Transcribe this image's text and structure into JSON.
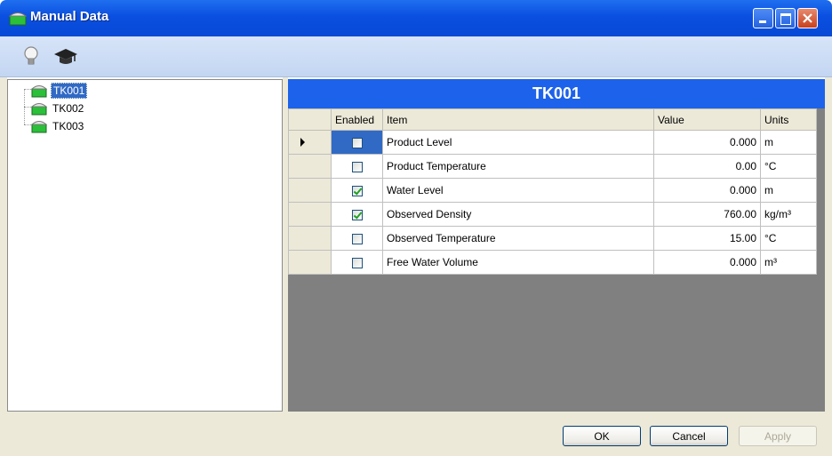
{
  "window": {
    "title": "Manual Data"
  },
  "toolbar": {
    "icons": [
      "lightbulb-icon",
      "graduation-cap-icon"
    ]
  },
  "tree": {
    "items": [
      {
        "label": "TK001",
        "selected": true
      },
      {
        "label": "TK002",
        "selected": false
      },
      {
        "label": "TK003",
        "selected": false
      }
    ]
  },
  "panel": {
    "title": "TK001"
  },
  "grid": {
    "headers": {
      "enabled": "Enabled",
      "item": "Item",
      "value": "Value",
      "units": "Units"
    },
    "rows": [
      {
        "enabled": false,
        "item": "Product Level",
        "value": "0.000",
        "units": "m",
        "current": true
      },
      {
        "enabled": false,
        "item": "Product Temperature",
        "value": "0.00",
        "units": "°C",
        "current": false
      },
      {
        "enabled": true,
        "item": "Water Level",
        "value": "0.000",
        "units": "m",
        "current": false
      },
      {
        "enabled": true,
        "item": "Observed Density",
        "value": "760.00",
        "units": "kg/m³",
        "current": false
      },
      {
        "enabled": false,
        "item": "Observed Temperature",
        "value": "15.00",
        "units": "°C",
        "current": false
      },
      {
        "enabled": false,
        "item": "Free Water Volume",
        "value": "0.000",
        "units": "m³",
        "current": false
      }
    ]
  },
  "buttons": {
    "ok": "OK",
    "cancel": "Cancel",
    "apply": "Apply"
  },
  "colors": {
    "title_bar": "#0a4fe0",
    "panel_header": "#1d62ea",
    "selection": "#316ac5",
    "grid_background": "#808080"
  }
}
